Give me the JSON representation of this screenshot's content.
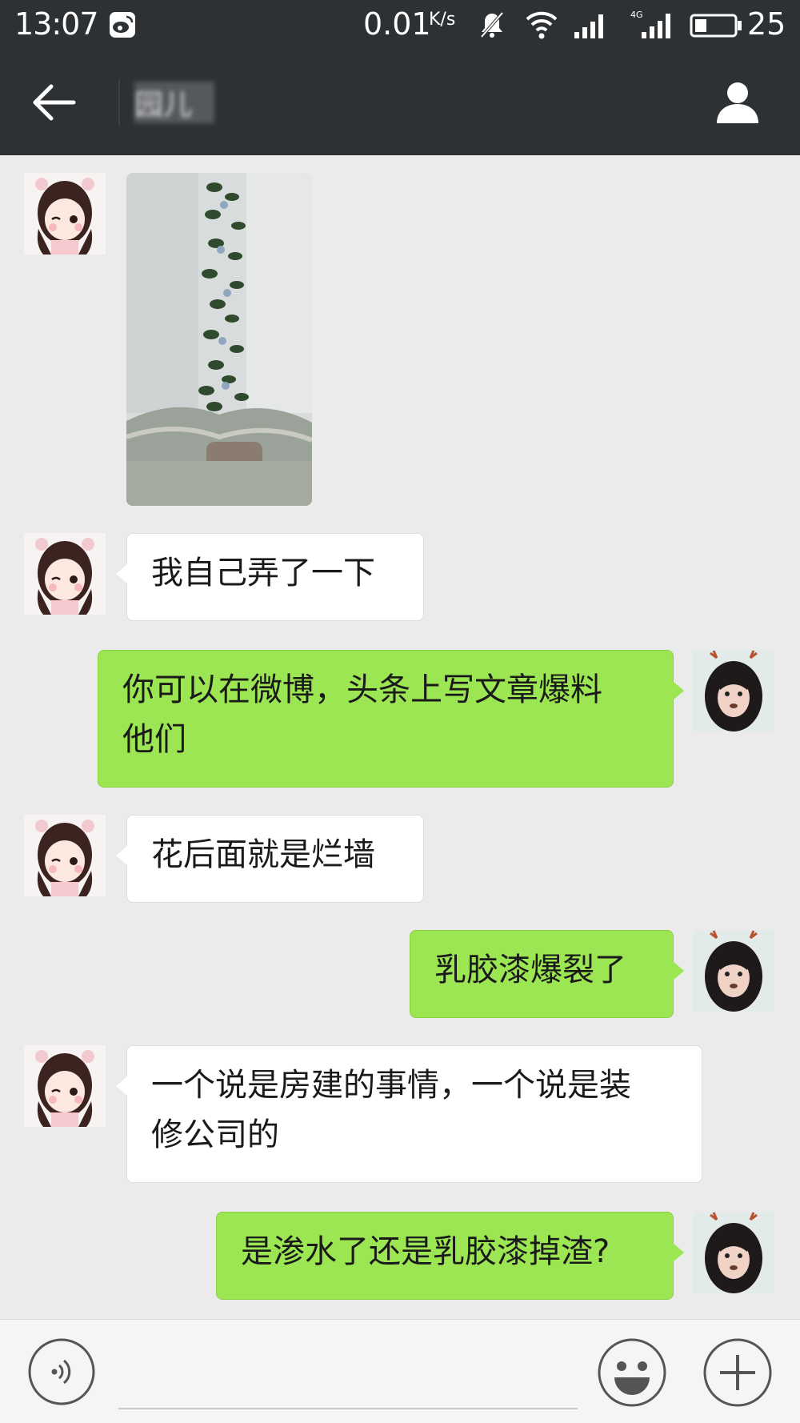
{
  "status_bar": {
    "time": "13:07",
    "speed": "0.01",
    "speed_unit": "K/s",
    "battery": "25",
    "icons": [
      "weibo-icon",
      "mute-icon",
      "wifi-icon",
      "signal-icon",
      "4g-signal-icon",
      "battery-icon"
    ]
  },
  "header": {
    "title": "园儿",
    "back_icon": "arrow-left-icon",
    "profile_icon": "person-icon"
  },
  "messages": [
    {
      "side": "left",
      "type": "image"
    },
    {
      "side": "left",
      "type": "text",
      "text": "我自己弄了一下"
    },
    {
      "side": "right",
      "type": "text",
      "lines": [
        "你可以在微博，头条上写文章爆料",
        "他们"
      ]
    },
    {
      "side": "left",
      "type": "text",
      "text": "花后面就是烂墙"
    },
    {
      "side": "right",
      "type": "text",
      "text": "乳胶漆爆裂了"
    },
    {
      "side": "left",
      "type": "text",
      "lines": [
        "一个说是房建的事情，一个说是装",
        "修公司的"
      ]
    },
    {
      "side": "right",
      "type": "text",
      "text": "是渗水了还是乳胶漆掉渣?"
    }
  ],
  "input_bar": {
    "voice_icon": "voice-icon",
    "emoji_icon": "emoji-icon",
    "plus_icon": "plus-icon",
    "placeholder": ""
  },
  "colors": {
    "header_bg": "#2e3134",
    "chat_bg": "#ebebeb",
    "outgoing_bubble": "#9de653",
    "incoming_bubble": "#ffffff"
  }
}
